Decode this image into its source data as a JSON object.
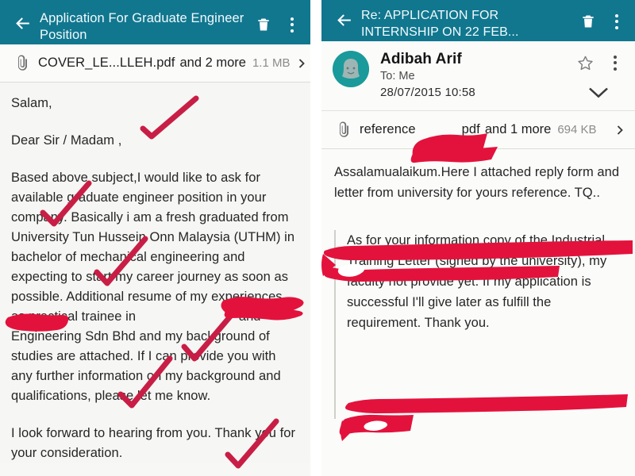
{
  "theme": {
    "appbar_color": "#11778f",
    "annotation_red": "#e3123c",
    "check_red": "#c81e45",
    "body_background": "#f6f6f4",
    "avatar_color": "#1a9a9a"
  },
  "left_panel": {
    "appbar": {
      "back_icon": "arrow-left-icon",
      "title": "Application For Graduate Engineer Position",
      "delete_icon": "trash-icon",
      "overflow_icon": "kebab-menu-icon"
    },
    "attachment": {
      "clip_icon": "paperclip-icon",
      "filename": "COVER_LE...LLEH.pdf",
      "more_label": "and 2 more",
      "size": "1.1 MB",
      "chevron_icon": "chevron-right-icon"
    },
    "message": {
      "greeting": "Salam,",
      "salutation": "Dear Sir / Madam ,",
      "paragraph_1": "Based above subject,I would like to ask for available graduate engineer position in your company. Basically i am a fresh graduated from University Tun Hussein Onn Malaysia (UTHM) in bachelor of mechanical engineering and expecting to start my career journey as soon as possible. Additional resume of my experiences as practical trainee in",
      "paragraph_1_cont": "and Engineering Sdn Bhd and my background of studies are attached. If I can provide you with any further information on my background and qualifications, please let me know.",
      "paragraph_2": "I look forward to hearing from you. Thank you for your consideration."
    },
    "annotations": {
      "checkmark_count": 5,
      "redaction_count": 2,
      "type": "hand-drawn-red-marker"
    }
  },
  "right_panel": {
    "appbar": {
      "back_icon": "arrow-left-icon",
      "title": "Re: APPLICATION FOR INTERNSHIP ON 22 FEB...",
      "delete_icon": "trash-icon",
      "overflow_icon": "kebab-menu-icon"
    },
    "sender": {
      "avatar_icon": "person-avatar-icon",
      "name": "Adibah Arif",
      "recipient": "To: Me",
      "date": "28/07/2015  10:58",
      "star_icon": "star-outline-icon",
      "overflow_icon": "kebab-menu-icon",
      "expand_icon": "chevron-down-icon"
    },
    "attachment": {
      "clip_icon": "paperclip-icon",
      "filename": "reference",
      "filename_suffix": "pdf",
      "more_label": "and 1 more",
      "size": "694 KB",
      "chevron_icon": "chevron-right-icon"
    },
    "message": {
      "paragraph_1": "Assalamualaikum.Here I attached reply form and letter from university for yours reference. TQ..",
      "quoted_paragraph": "As for your information copy of the Industrial Training Letter (signed by the university), my faculty not provide yet. If my application is successful I'll give later as fulfill the requirement. Thank you."
    },
    "annotations": {
      "redaction_count": 3,
      "type": "hand-drawn-red-marker"
    }
  }
}
